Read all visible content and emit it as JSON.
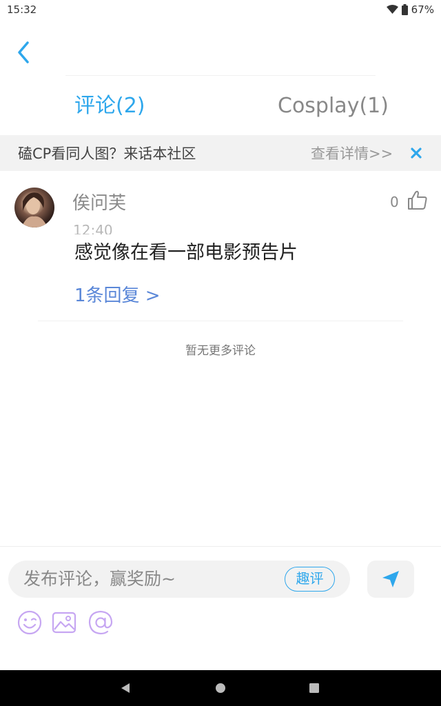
{
  "status_bar": {
    "time": "15:32",
    "battery": "67%",
    "icons": [
      "wifi-icon",
      "battery-icon"
    ]
  },
  "header": {
    "back_icon": "chevron-left-icon"
  },
  "tabs": [
    {
      "label": "评论(2)",
      "active": true
    },
    {
      "label": "Cosplay(1)",
      "active": false
    }
  ],
  "banner": {
    "text": "磕CP看同人图？来话本社区",
    "link": "查看详情>>",
    "close_icon": "close-icon"
  },
  "comments": [
    {
      "author": "俟问芙",
      "time": "12:40",
      "likes": "0",
      "text": "感觉像在看一部电影预告片",
      "replies_link": "1条回复 >"
    }
  ],
  "no_more_text": "暂无更多评论",
  "composer": {
    "placeholder": "发布评论，赢奖励~",
    "fun_review": "趣评",
    "icons": [
      "send-icon",
      "emoji-icon",
      "image-icon",
      "at-icon"
    ]
  },
  "colors": {
    "accent": "#2ea7ec",
    "link": "#5a87d8",
    "tool_icon": "#c6a6f2"
  }
}
